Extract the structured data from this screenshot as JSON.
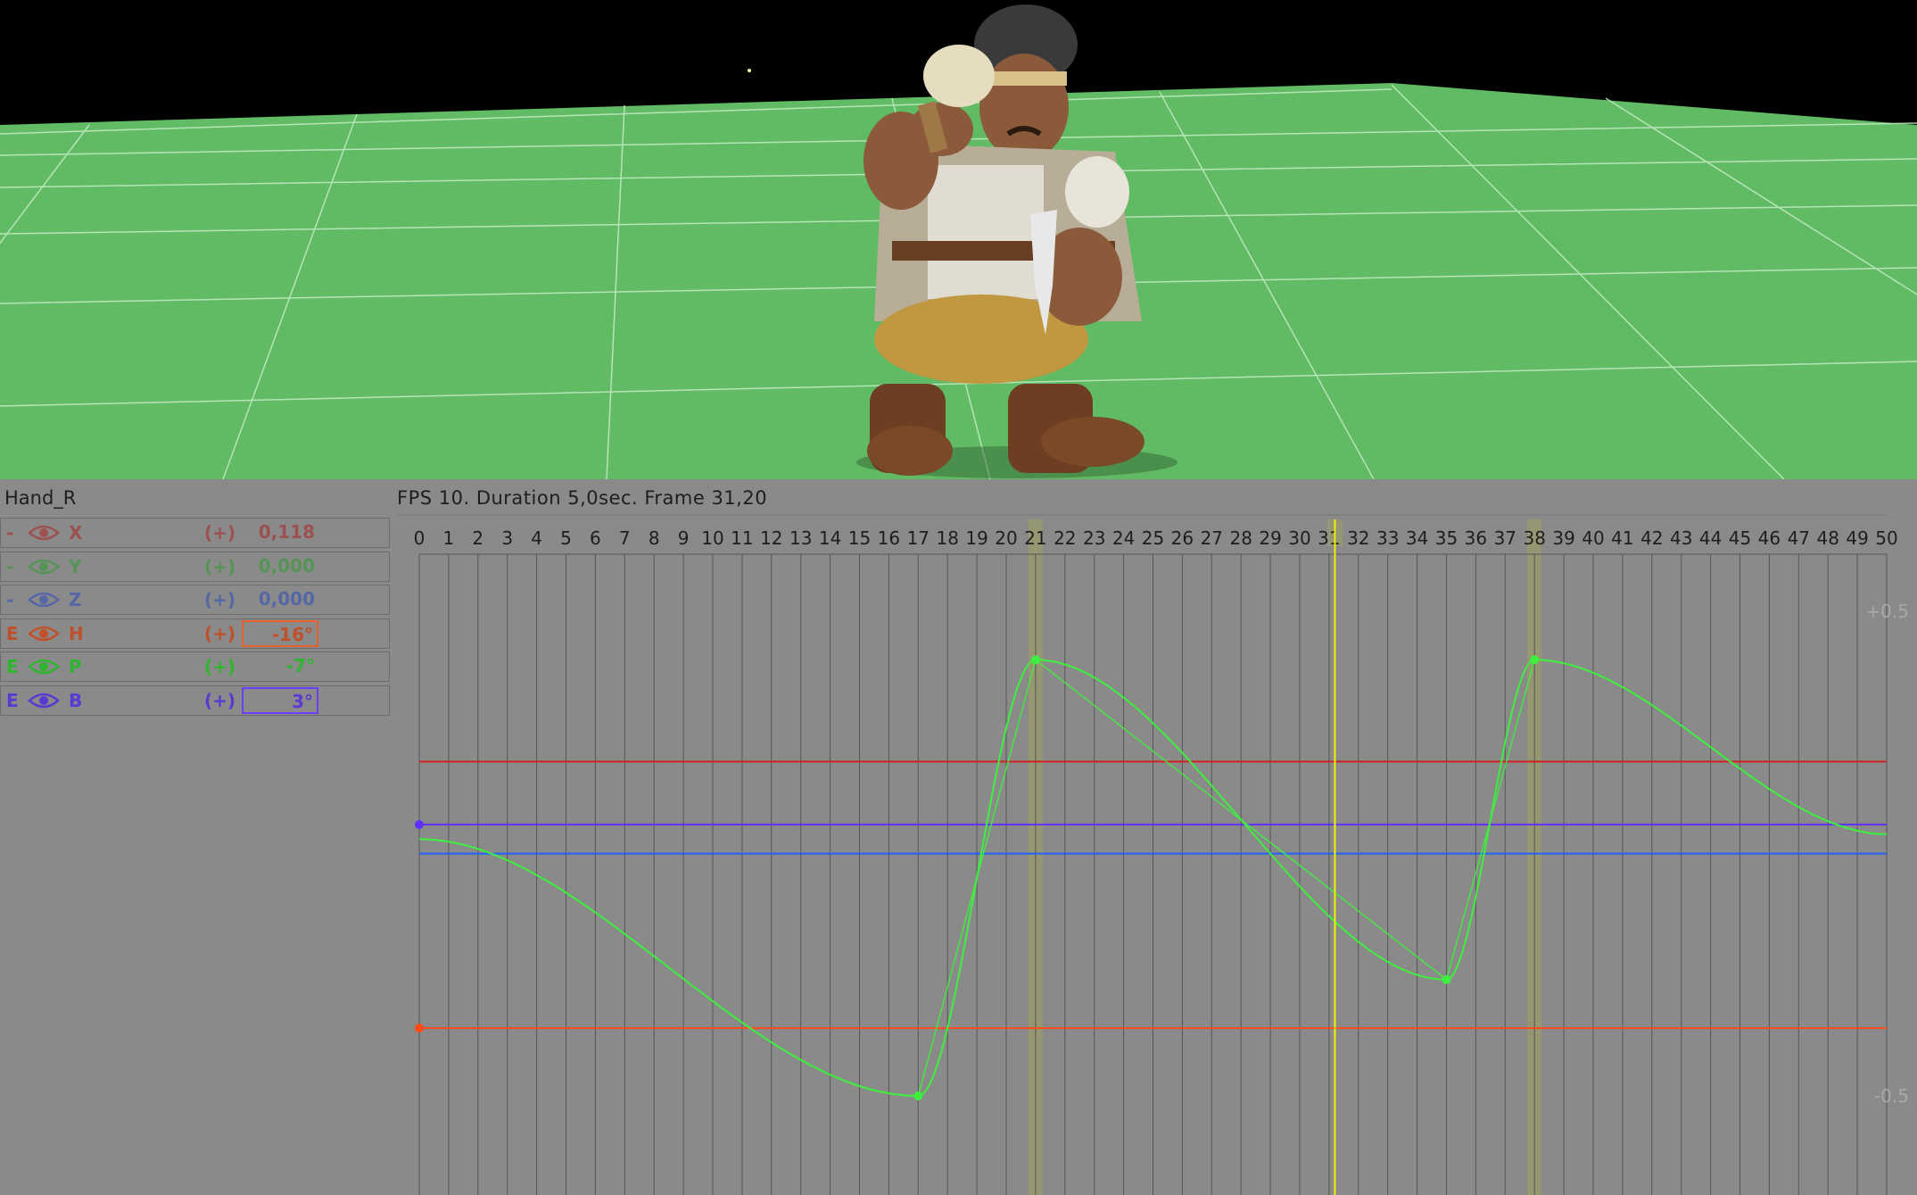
{
  "bone": {
    "name": "Hand_R"
  },
  "animation": {
    "info": "FPS 10. Duration 5,0sec. Frame 31,20"
  },
  "channels": [
    {
      "prefix": "-",
      "axis": "X",
      "add": "(+)",
      "value": "0,118",
      "color": "#a83232",
      "dim": true,
      "box": null
    },
    {
      "prefix": "-",
      "axis": "Y",
      "add": "(+)",
      "value": "0,000",
      "color": "#3a9a3a",
      "dim": true,
      "box": null
    },
    {
      "prefix": "-",
      "axis": "Z",
      "add": "(+)",
      "value": "0,000",
      "color": "#3a55b4",
      "dim": true,
      "box": null
    },
    {
      "prefix": "E",
      "axis": "H",
      "add": "(+)",
      "value": "-16°",
      "color": "#c0502a",
      "dim": false,
      "box": "#e8602a"
    },
    {
      "prefix": "E",
      "axis": "P",
      "add": "(+)",
      "value": "-7°",
      "color": "#2fb52f",
      "dim": false,
      "box": null
    },
    {
      "prefix": "E",
      "axis": "B",
      "add": "(+)",
      "value": "3°",
      "color": "#5a3ad0",
      "dim": false,
      "box": "#6a40ff"
    }
  ],
  "timeline": {
    "frames": [
      "0",
      "1",
      "2",
      "3",
      "4",
      "5",
      "6",
      "7",
      "8",
      "9",
      "10",
      "11",
      "12",
      "13",
      "14",
      "15",
      "16",
      "17",
      "18",
      "19",
      "20",
      "21",
      "22",
      "23",
      "24",
      "25",
      "26",
      "27",
      "28",
      "29",
      "30",
      "31",
      "32",
      "33",
      "34",
      "35",
      "36",
      "37",
      "38",
      "39",
      "40",
      "41",
      "42",
      "43",
      "44",
      "45",
      "46",
      "47",
      "48",
      "49",
      "50"
    ],
    "current_frame": 31.2,
    "key_frames": [
      21,
      38
    ],
    "y_labels": {
      "top": "+0.5",
      "bottom": "-0.5"
    },
    "colors": {
      "grid": "#555555",
      "curve": "#3ef03e",
      "key_band": "#a0a060",
      "playhead": "#f0f000"
    }
  },
  "curves": {
    "green_keys": [
      {
        "frame": 0,
        "value": 0.03
      },
      {
        "frame": 17,
        "value": -0.5
      },
      {
        "frame": 21,
        "value": 0.4
      },
      {
        "frame": 35,
        "value": -0.26
      },
      {
        "frame": 38,
        "value": 0.4
      },
      {
        "frame": 50,
        "value": 0.04
      }
    ],
    "flat_lines": [
      {
        "name": "red-line",
        "value": 0.19,
        "color": "#d02020",
        "key": false
      },
      {
        "name": "purple-line",
        "value": 0.06,
        "color": "#6030ff",
        "key": true
      },
      {
        "name": "blue-line",
        "value": 0.0,
        "color": "#2060ff",
        "key": false
      },
      {
        "name": "orange-line",
        "value": -0.36,
        "color": "#ff4a1a",
        "key": true
      }
    ]
  },
  "scene": {
    "sky_color": "#000000",
    "ground_color": "#61bb65",
    "grid_color": "#bfe9c0"
  }
}
